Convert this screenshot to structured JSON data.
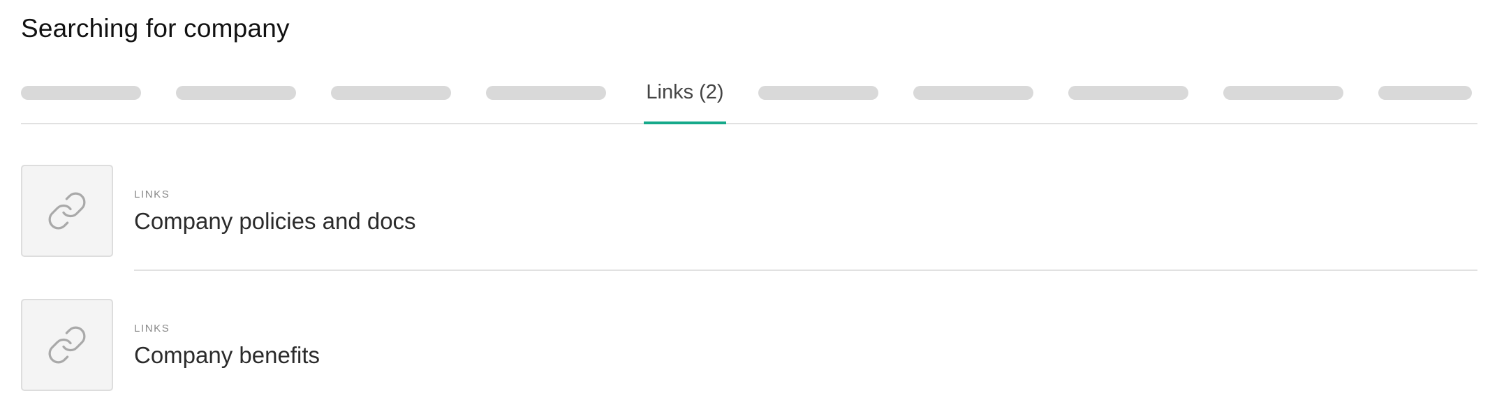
{
  "page": {
    "title": "Searching for company"
  },
  "tabs": {
    "active_label": "Links (2)",
    "accent_color": "#16a98a",
    "placeholder_count": 9
  },
  "results": [
    {
      "kind": "LINKS",
      "name": "Company policies and docs",
      "icon": "link-icon"
    },
    {
      "kind": "LINKS",
      "name": "Company benefits",
      "icon": "link-icon"
    }
  ]
}
